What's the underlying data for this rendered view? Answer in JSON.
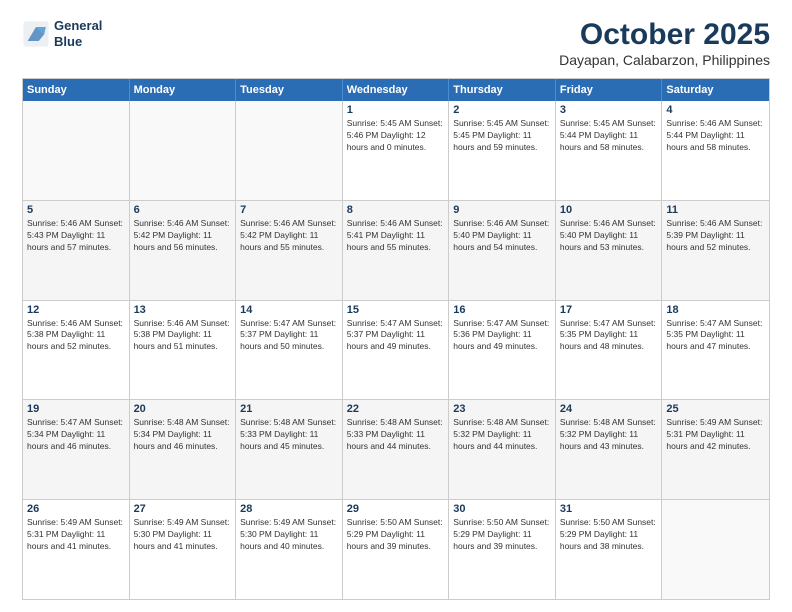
{
  "logo": {
    "line1": "General",
    "line2": "Blue"
  },
  "title": "October 2025",
  "subtitle": "Dayapan, Calabarzon, Philippines",
  "dayHeaders": [
    "Sunday",
    "Monday",
    "Tuesday",
    "Wednesday",
    "Thursday",
    "Friday",
    "Saturday"
  ],
  "weeks": [
    [
      {
        "day": "",
        "info": "",
        "empty": true
      },
      {
        "day": "",
        "info": "",
        "empty": true
      },
      {
        "day": "",
        "info": "",
        "empty": true
      },
      {
        "day": "1",
        "info": "Sunrise: 5:45 AM\nSunset: 5:46 PM\nDaylight: 12 hours\nand 0 minutes."
      },
      {
        "day": "2",
        "info": "Sunrise: 5:45 AM\nSunset: 5:45 PM\nDaylight: 11 hours\nand 59 minutes."
      },
      {
        "day": "3",
        "info": "Sunrise: 5:45 AM\nSunset: 5:44 PM\nDaylight: 11 hours\nand 58 minutes."
      },
      {
        "day": "4",
        "info": "Sunrise: 5:46 AM\nSunset: 5:44 PM\nDaylight: 11 hours\nand 58 minutes."
      }
    ],
    [
      {
        "day": "5",
        "info": "Sunrise: 5:46 AM\nSunset: 5:43 PM\nDaylight: 11 hours\nand 57 minutes."
      },
      {
        "day": "6",
        "info": "Sunrise: 5:46 AM\nSunset: 5:42 PM\nDaylight: 11 hours\nand 56 minutes."
      },
      {
        "day": "7",
        "info": "Sunrise: 5:46 AM\nSunset: 5:42 PM\nDaylight: 11 hours\nand 55 minutes."
      },
      {
        "day": "8",
        "info": "Sunrise: 5:46 AM\nSunset: 5:41 PM\nDaylight: 11 hours\nand 55 minutes."
      },
      {
        "day": "9",
        "info": "Sunrise: 5:46 AM\nSunset: 5:40 PM\nDaylight: 11 hours\nand 54 minutes."
      },
      {
        "day": "10",
        "info": "Sunrise: 5:46 AM\nSunset: 5:40 PM\nDaylight: 11 hours\nand 53 minutes."
      },
      {
        "day": "11",
        "info": "Sunrise: 5:46 AM\nSunset: 5:39 PM\nDaylight: 11 hours\nand 52 minutes."
      }
    ],
    [
      {
        "day": "12",
        "info": "Sunrise: 5:46 AM\nSunset: 5:38 PM\nDaylight: 11 hours\nand 52 minutes."
      },
      {
        "day": "13",
        "info": "Sunrise: 5:46 AM\nSunset: 5:38 PM\nDaylight: 11 hours\nand 51 minutes."
      },
      {
        "day": "14",
        "info": "Sunrise: 5:47 AM\nSunset: 5:37 PM\nDaylight: 11 hours\nand 50 minutes."
      },
      {
        "day": "15",
        "info": "Sunrise: 5:47 AM\nSunset: 5:37 PM\nDaylight: 11 hours\nand 49 minutes."
      },
      {
        "day": "16",
        "info": "Sunrise: 5:47 AM\nSunset: 5:36 PM\nDaylight: 11 hours\nand 49 minutes."
      },
      {
        "day": "17",
        "info": "Sunrise: 5:47 AM\nSunset: 5:35 PM\nDaylight: 11 hours\nand 48 minutes."
      },
      {
        "day": "18",
        "info": "Sunrise: 5:47 AM\nSunset: 5:35 PM\nDaylight: 11 hours\nand 47 minutes."
      }
    ],
    [
      {
        "day": "19",
        "info": "Sunrise: 5:47 AM\nSunset: 5:34 PM\nDaylight: 11 hours\nand 46 minutes."
      },
      {
        "day": "20",
        "info": "Sunrise: 5:48 AM\nSunset: 5:34 PM\nDaylight: 11 hours\nand 46 minutes."
      },
      {
        "day": "21",
        "info": "Sunrise: 5:48 AM\nSunset: 5:33 PM\nDaylight: 11 hours\nand 45 minutes."
      },
      {
        "day": "22",
        "info": "Sunrise: 5:48 AM\nSunset: 5:33 PM\nDaylight: 11 hours\nand 44 minutes."
      },
      {
        "day": "23",
        "info": "Sunrise: 5:48 AM\nSunset: 5:32 PM\nDaylight: 11 hours\nand 44 minutes."
      },
      {
        "day": "24",
        "info": "Sunrise: 5:48 AM\nSunset: 5:32 PM\nDaylight: 11 hours\nand 43 minutes."
      },
      {
        "day": "25",
        "info": "Sunrise: 5:49 AM\nSunset: 5:31 PM\nDaylight: 11 hours\nand 42 minutes."
      }
    ],
    [
      {
        "day": "26",
        "info": "Sunrise: 5:49 AM\nSunset: 5:31 PM\nDaylight: 11 hours\nand 41 minutes."
      },
      {
        "day": "27",
        "info": "Sunrise: 5:49 AM\nSunset: 5:30 PM\nDaylight: 11 hours\nand 41 minutes."
      },
      {
        "day": "28",
        "info": "Sunrise: 5:49 AM\nSunset: 5:30 PM\nDaylight: 11 hours\nand 40 minutes."
      },
      {
        "day": "29",
        "info": "Sunrise: 5:50 AM\nSunset: 5:29 PM\nDaylight: 11 hours\nand 39 minutes."
      },
      {
        "day": "30",
        "info": "Sunrise: 5:50 AM\nSunset: 5:29 PM\nDaylight: 11 hours\nand 39 minutes."
      },
      {
        "day": "31",
        "info": "Sunrise: 5:50 AM\nSunset: 5:29 PM\nDaylight: 11 hours\nand 38 minutes."
      },
      {
        "day": "",
        "info": "",
        "empty": true
      }
    ]
  ]
}
